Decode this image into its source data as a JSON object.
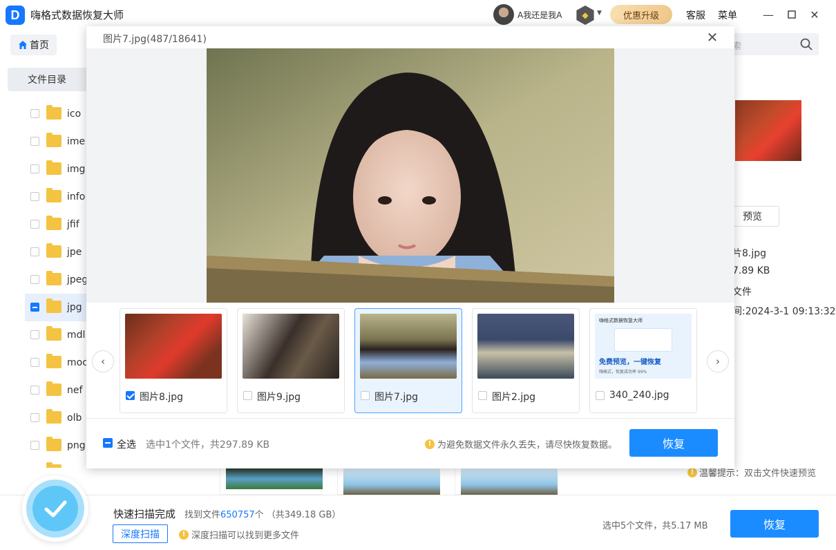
{
  "app": {
    "title": "嗨格式数据恢复大师",
    "logo_letter": "D"
  },
  "user": {
    "name": "A我还是我A"
  },
  "header": {
    "upgrade": "优惠升级",
    "service": "客服",
    "menu": "菜单"
  },
  "toolbar": {
    "home": "首页",
    "search_placeholder": "索"
  },
  "sidebar": {
    "header": "文件目录",
    "items": [
      {
        "label": "ico"
      },
      {
        "label": "ime"
      },
      {
        "label": "img"
      },
      {
        "label": "info"
      },
      {
        "label": "jfif"
      },
      {
        "label": "jpe"
      },
      {
        "label": "jpeg"
      },
      {
        "label": "jpg"
      },
      {
        "label": "mdl"
      },
      {
        "label": "moc"
      },
      {
        "label": "nef"
      },
      {
        "label": "olb"
      },
      {
        "label": "png"
      }
    ]
  },
  "right_panel": {
    "preview_btn": "预览",
    "name": "片8.jpg",
    "size": "7.89 KB",
    "type": "文件",
    "modified": "间:2024-3-1 09:13:32",
    "tip": "温馨提示：双击文件快速预览"
  },
  "modal": {
    "title": "图片7.jpg(487/18641)",
    "thumbnails": [
      {
        "name": "图片8.jpg",
        "checked": true
      },
      {
        "name": "图片9.jpg",
        "checked": false
      },
      {
        "name": "图片7.jpg",
        "checked": false
      },
      {
        "name": "图片2.jpg",
        "checked": false
      },
      {
        "name": "340_240.jpg",
        "checked": false
      }
    ],
    "ad_thumb": {
      "brand": "嗨格式数据恢复大师",
      "headline": "免费预览，一键恢复",
      "sub": "嗨格式，恢复成功率 99%"
    },
    "select_all": "全选",
    "summary": "选中1个文件，共297.89 KB",
    "warning": "为避免数据文件永久丢失，请尽快恢复数据。",
    "recover": "恢复"
  },
  "bottom": {
    "status": "快速扫描完成",
    "found_prefix": "找到文件",
    "found_count": "650757",
    "found_suffix": "个 （共349.18 GB）",
    "deep_scan": "深度扫描",
    "deep_tip": "深度扫描可以找到更多文件",
    "selected": "选中5个文件，共5.17 MB",
    "recover": "恢复"
  },
  "colors": {
    "accent": "#1b8cff",
    "folder": "#f5c342"
  }
}
